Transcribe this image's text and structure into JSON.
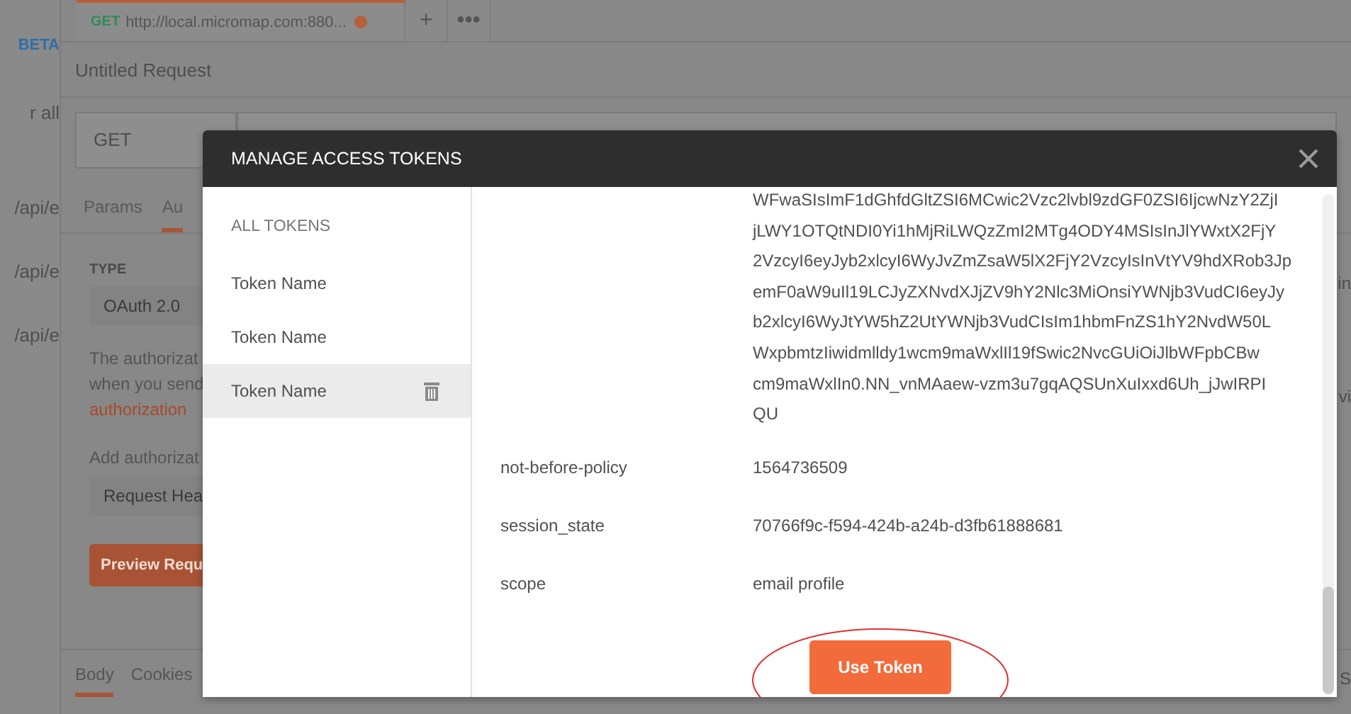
{
  "sidebar": {
    "items": [
      {
        "text": "BETA",
        "kind": "badge"
      },
      {
        "text": "r all",
        "kind": "text"
      },
      {
        "text": "/api/e",
        "kind": "history"
      },
      {
        "text": "/api/e",
        "kind": "history"
      },
      {
        "text": "/api/e",
        "kind": "history"
      }
    ]
  },
  "request_tabs": [
    {
      "method": "GET",
      "url": "http://local.micromap.com:880...",
      "unsaved": true,
      "selected": true
    }
  ],
  "tab_actions": [
    "+",
    "•••"
  ],
  "request": {
    "title": "Untitled Request",
    "method": "GET"
  },
  "subtabs": [
    {
      "label": "Params",
      "selected": false
    },
    {
      "label": "Au",
      "selected": true
    }
  ],
  "auth": {
    "type_label": "TYPE",
    "type": "OAuth 2.0",
    "description_lines": [
      "The authorizat",
      "when you send"
    ],
    "link": "authorization",
    "add_label": "Add authorizat",
    "add_to": "Request Hea",
    "preview_button": "Preview Requ"
  },
  "response_tabs": [
    {
      "label": "Body",
      "selected": true
    },
    {
      "label": "Cookies",
      "selected": false
    }
  ],
  "right_edge": [
    "in",
    "vi",
    "S"
  ],
  "modal": {
    "title": "MANAGE ACCESS TOKENS",
    "list_heading": "ALL TOKENS",
    "tokens": [
      {
        "name": "Token Name",
        "selected": false
      },
      {
        "name": "Token Name",
        "selected": false
      },
      {
        "name": "Token Name",
        "selected": true
      }
    ],
    "details": [
      {
        "value_lines": [
          "WFwaSIsImF1dGhfdGltZSI6MCwic2Vzc2lvbl9zdGF0ZSI6IjcwNzY2ZjI",
          "jLWY1OTQtNDI0Yi1hMjRiLWQzZmI2MTg4ODY4MSIsInJlYWxtX2FjY",
          "2VzcyI6eyJyb2xlcyI6WyJvZmZsaW5lX2FjY2VzcyIsInVtYV9hdXRob3Jp",
          "emF0aW9uIl19LCJyZXNvdXJjZV9hY2Nlc3MiOnsiYWNjb3VudCI6eyJy",
          "b2xlcyI6WyJtYW5hZ2UtYWNjb3VudCIsIm1hbmFnZS1hY2NvdW50L",
          "WxpbmtzIiwidmlldy1wcm9maWxlIl19fSwic2NvcGUiOiJlbWFpbCBw",
          "cm9maWxlIn0.NN_vnMAaew-vzm3u7gqAQSUnXuIxxd6Uh_jJwIRPI",
          "QU"
        ]
      },
      {
        "key": "not-before-policy",
        "value": "1564736509"
      },
      {
        "key": "session_state",
        "value": "70766f9c-f594-424b-a24b-d3fb61888681"
      },
      {
        "key": "scope",
        "value": "email profile"
      }
    ],
    "button": "Use Token",
    "highlight": {
      "kind": "ellipse"
    }
  }
}
